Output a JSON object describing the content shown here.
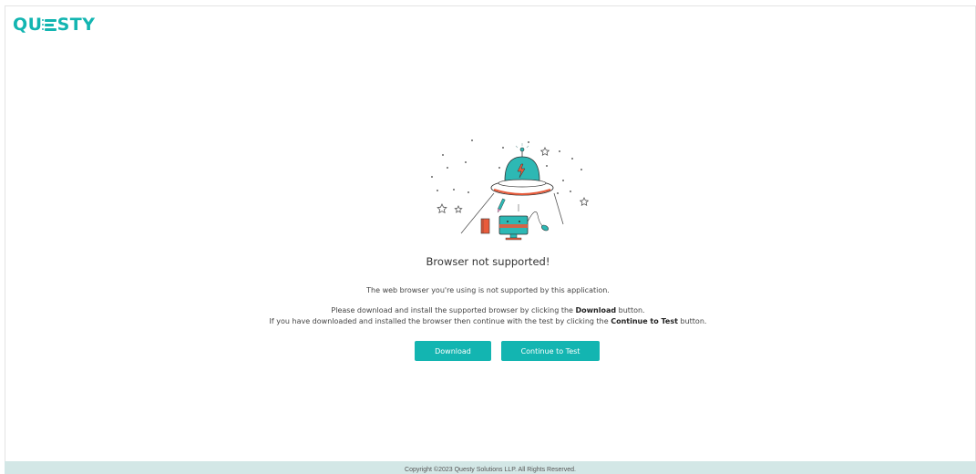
{
  "brand": {
    "prefix": "QU",
    "suffix": "STY",
    "color": "#13b5b1"
  },
  "page": {
    "title": "Browser not supported!",
    "line1": "The web browser you're using is not supported by this application.",
    "line2_pre": "Please download and install the supported browser by clicking the ",
    "line2_bold": "Download",
    "line2_post": " button.",
    "line3_pre": "If you have downloaded and installed the browser then continue with the test by clicking the ",
    "line3_bold": "Continue to Test",
    "line3_post": " button."
  },
  "buttons": {
    "download": "Download",
    "continue": "Continue to Test"
  },
  "footer": {
    "text": "Copyright ©2023 Questy Solutions LLP. All Rights Reserved."
  },
  "colors": {
    "accent": "#13b5b1",
    "ufo_teal": "#2db8b4",
    "ufo_orange": "#e85b3b",
    "footer_bg": "#d3e7e6"
  }
}
